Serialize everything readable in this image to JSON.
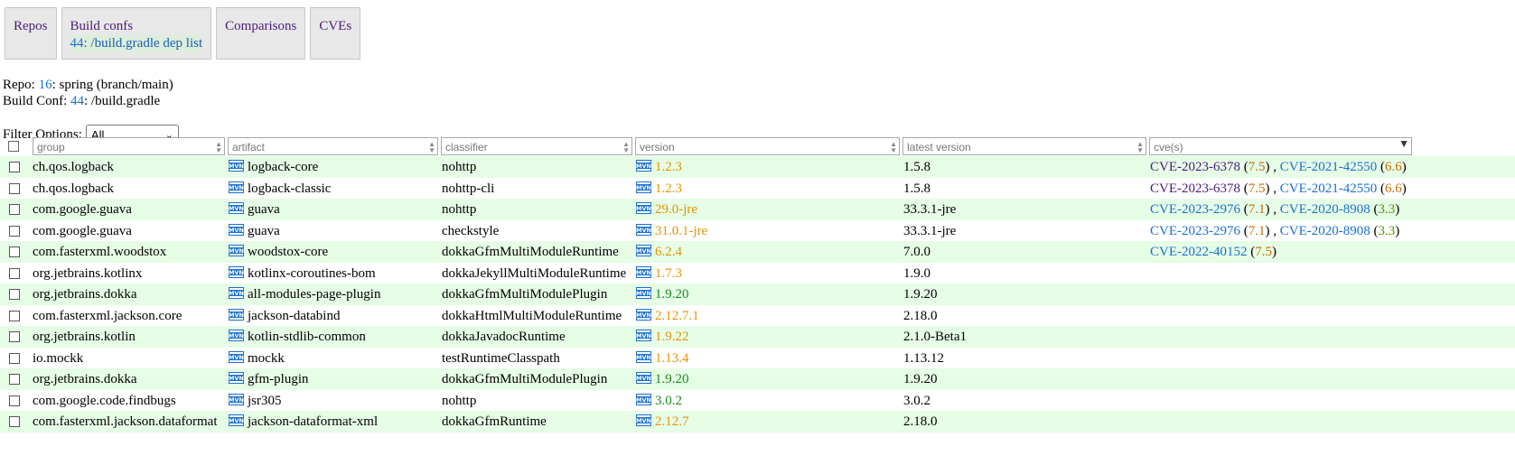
{
  "tabs": [
    {
      "label": "Repos"
    },
    {
      "label": "Build confs",
      "sub_num": "44",
      "sub_text": ": /build.gradle dep list"
    },
    {
      "label": "Comparisons"
    },
    {
      "label": "CVEs"
    }
  ],
  "repo": {
    "prefix": "Repo: ",
    "id": "16",
    "text": ": spring (branch/main)"
  },
  "build_conf": {
    "prefix": "Build Conf: ",
    "id": "44",
    "text": ": /build.gradle"
  },
  "filter": {
    "label": "Filter Options:",
    "selected": "All"
  },
  "columns": [
    {
      "placeholder": "group"
    },
    {
      "placeholder": "artifact"
    },
    {
      "placeholder": "classifier"
    },
    {
      "placeholder": "version"
    },
    {
      "placeholder": "latest version"
    },
    {
      "placeholder": "cve(s)"
    }
  ],
  "colors": {
    "row_even": "#e6fde6",
    "version_latest": "#1a8a1a",
    "version_outdated": "#e59400",
    "link": "#1a6fd0",
    "visited_link": "#4b1b7a"
  },
  "icons": {
    "maven": "mvn-icon",
    "sort": "sort-arrows-icon"
  },
  "rows": [
    {
      "group": "ch.qos.logback",
      "artifact": "logback-core",
      "classifier": "nohttp",
      "version": "1.2.3",
      "version_status": "outdated",
      "latest": "1.5.8",
      "cves": [
        {
          "id": "CVE-2023-6378",
          "score": "7.5",
          "visited": true
        },
        {
          "id": "CVE-2021-42550",
          "score": "6.6",
          "visited": false
        }
      ]
    },
    {
      "group": "ch.qos.logback",
      "artifact": "logback-classic",
      "classifier": "nohttp-cli",
      "version": "1.2.3",
      "version_status": "outdated",
      "latest": "1.5.8",
      "cves": [
        {
          "id": "CVE-2023-6378",
          "score": "7.5",
          "visited": true
        },
        {
          "id": "CVE-2021-42550",
          "score": "6.6",
          "visited": false
        }
      ]
    },
    {
      "group": "com.google.guava",
      "artifact": "guava",
      "classifier": "nohttp",
      "version": "29.0-jre",
      "version_status": "outdated",
      "latest": "33.3.1-jre",
      "cves": [
        {
          "id": "CVE-2023-2976",
          "score": "7.1",
          "visited": false
        },
        {
          "id": "CVE-2020-8908",
          "score": "3.3",
          "visited": false
        }
      ]
    },
    {
      "group": "com.google.guava",
      "artifact": "guava",
      "classifier": "checkstyle",
      "version": "31.0.1-jre",
      "version_status": "outdated",
      "latest": "33.3.1-jre",
      "cves": [
        {
          "id": "CVE-2023-2976",
          "score": "7.1",
          "visited": false
        },
        {
          "id": "CVE-2020-8908",
          "score": "3.3",
          "visited": false
        }
      ]
    },
    {
      "group": "com.fasterxml.woodstox",
      "artifact": "woodstox-core",
      "classifier": "dokkaGfmMultiModuleRuntime",
      "version": "6.2.4",
      "version_status": "outdated",
      "latest": "7.0.0",
      "cves": [
        {
          "id": "CVE-2022-40152",
          "score": "7.5",
          "visited": false
        }
      ]
    },
    {
      "group": "org.jetbrains.kotlinx",
      "artifact": "kotlinx-coroutines-bom",
      "classifier": "dokkaJekyllMultiModuleRuntime",
      "version": "1.7.3",
      "version_status": "outdated",
      "latest": "1.9.0",
      "cves": []
    },
    {
      "group": "org.jetbrains.dokka",
      "artifact": "all-modules-page-plugin",
      "classifier": "dokkaGfmMultiModulePlugin",
      "version": "1.9.20",
      "version_status": "latest",
      "latest": "1.9.20",
      "cves": []
    },
    {
      "group": "com.fasterxml.jackson.core",
      "artifact": "jackson-databind",
      "classifier": "dokkaHtmlMultiModuleRuntime",
      "version": "2.12.7.1",
      "version_status": "outdated",
      "latest": "2.18.0",
      "cves": []
    },
    {
      "group": "org.jetbrains.kotlin",
      "artifact": "kotlin-stdlib-common",
      "classifier": "dokkaJavadocRuntime",
      "version": "1.9.22",
      "version_status": "outdated",
      "latest": "2.1.0-Beta1",
      "cves": []
    },
    {
      "group": "io.mockk",
      "artifact": "mockk",
      "classifier": "testRuntimeClasspath",
      "version": "1.13.4",
      "version_status": "outdated",
      "latest": "1.13.12",
      "cves": []
    },
    {
      "group": "org.jetbrains.dokka",
      "artifact": "gfm-plugin",
      "classifier": "dokkaGfmMultiModulePlugin",
      "version": "1.9.20",
      "version_status": "latest",
      "latest": "1.9.20",
      "cves": []
    },
    {
      "group": "com.google.code.findbugs",
      "artifact": "jsr305",
      "classifier": "nohttp",
      "version": "3.0.2",
      "version_status": "latest",
      "latest": "3.0.2",
      "cves": []
    },
    {
      "group": "com.fasterxml.jackson.dataformat",
      "artifact": "jackson-dataformat-xml",
      "classifier": "dokkaGfmRuntime",
      "version": "2.12.7",
      "version_status": "outdated",
      "latest": "2.18.0",
      "cves": []
    }
  ]
}
